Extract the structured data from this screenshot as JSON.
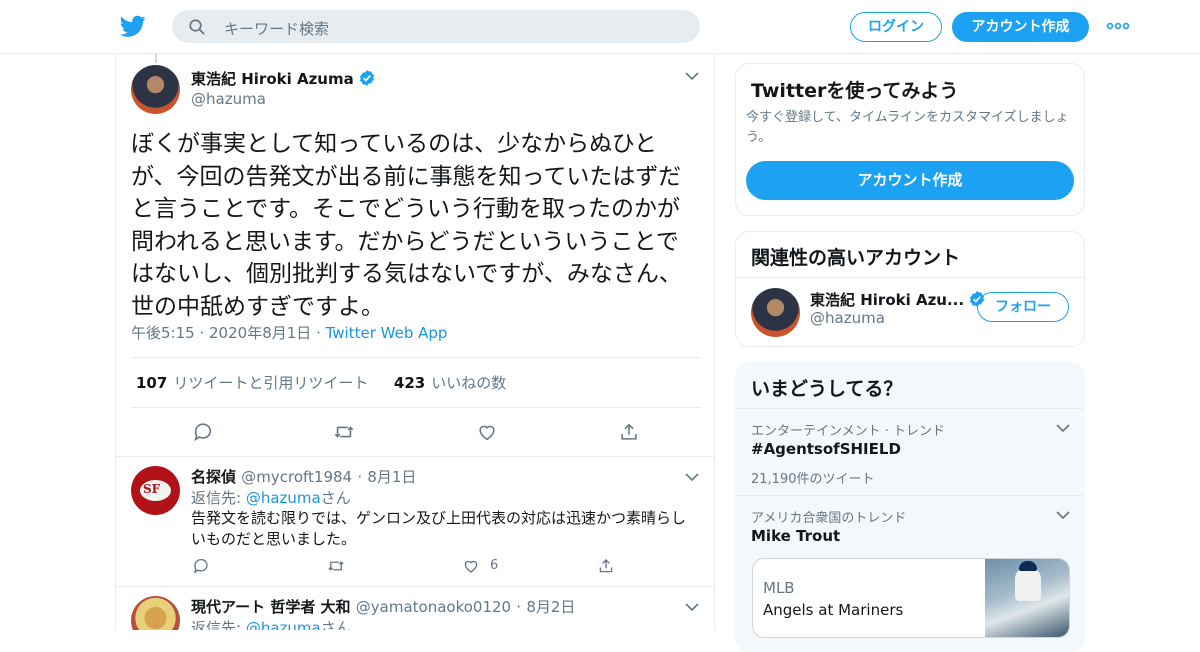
{
  "topbar": {
    "search_placeholder": "キーワード検索",
    "login_label": "ログイン",
    "signup_label": "アカウント作成",
    "brand_color": "#1da1f2"
  },
  "tweet": {
    "author_name": "東浩紀 Hiroki Azuma",
    "author_handle": "@hazuma",
    "text": "ぼくが事実として知っているのは、少なからぬひとが、今回の告発文が出る前に事態を知っていたはずだと言うことです。そこでどういう行動を取ったのかが問われると思います。だからどうだといういうことではないし、個別批判する気はないですが、みなさん、世の中舐めすぎですよ。",
    "time": "午後5:15",
    "date": "2020年8月1日",
    "source": "Twitter Web App",
    "retweets_count": "107",
    "retweets_label": "リツイートと引用リツイート",
    "likes_count": "423",
    "likes_label": "いいねの数"
  },
  "replies": [
    {
      "name": "名探偵",
      "handle": "@mycroft1984",
      "date": "8月1日",
      "reply_prefix": "返信先:",
      "reply_to": "@hazuma",
      "reply_suffix": "さん",
      "text": "告発文を読む限りでは、ゲンロン及び上田代表の対応は迅速かつ素晴らしいものだと思いました。",
      "like_count": "6",
      "avatar_text": "SF"
    },
    {
      "name": "現代アート 哲学者 大和",
      "handle": "@yamatonaoko0120",
      "date": "8月2日",
      "reply_prefix": "返信先:",
      "reply_to": "@hazuma",
      "reply_suffix": "さん"
    }
  ],
  "sidebar": {
    "try_card": {
      "title": "Twitterを使ってみよう",
      "subtitle": "今すぐ登録して、タイムラインをカスタマイズしましょう。",
      "button_label": "アカウント作成"
    },
    "related_card": {
      "title": "関連性の高いアカウント",
      "account_name": "東浩紀 Hiroki Azu...",
      "account_handle": "@hazuma",
      "follow_label": "フォロー"
    },
    "trends_card": {
      "title": "いまどうしてる？",
      "items": [
        {
          "context": "エンターテインメント · トレンド",
          "name": "#AgentsofSHIELD",
          "count": "21,190件のツイート"
        },
        {
          "context": "アメリカ合衆国のトレンド",
          "name": "Mike Trout"
        }
      ],
      "mlb_card": {
        "label": "MLB",
        "title": "Angels at Mariners"
      }
    }
  }
}
